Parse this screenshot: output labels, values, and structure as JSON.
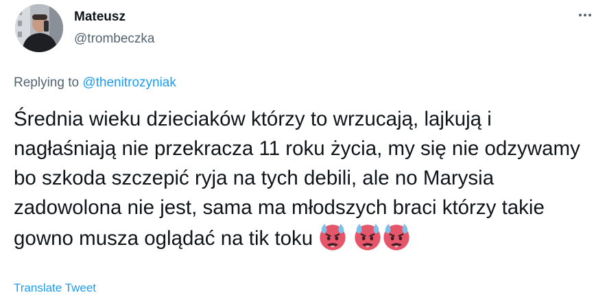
{
  "author": {
    "name": "Mateusz",
    "handle": "@trombeczka"
  },
  "reply": {
    "prefix": "Replying to",
    "to_handle": "@thenitrozyniak"
  },
  "tweet": {
    "text": "Średnia wieku dzieciaków którzy to wrzucają, lajkują i nagłaśniają nie przekracza 11 roku życia, my się nie odzywamy bo szkoda szczepić ryja na tych debili, ale no Marysia zadowolona nie jest, sama ma młodszych braci którzy takie gowno musza oglądać na tik toku",
    "emojis": [
      "hot-face-emoji",
      "hot-face-emoji",
      "hot-face-emoji"
    ]
  },
  "translate_label": "Translate Tweet",
  "colors": {
    "text": "#0f1419",
    "secondary": "#536471",
    "link": "#1d9bf0",
    "emoji_face": "#e5566b"
  },
  "icons": {
    "more": "more-horizontal-icon"
  }
}
